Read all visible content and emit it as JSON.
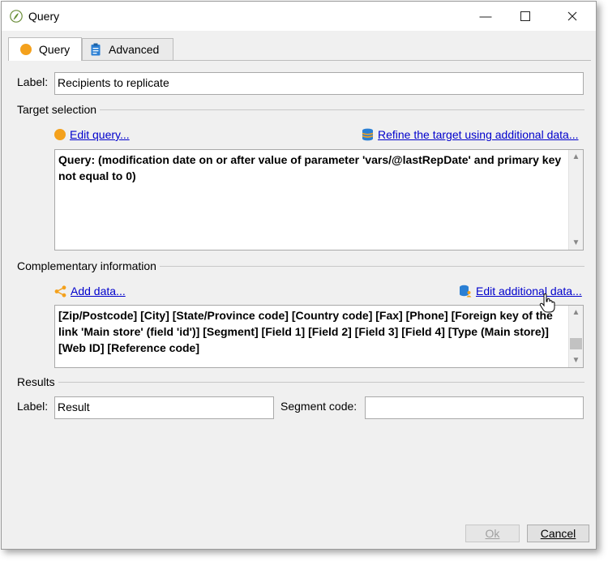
{
  "window": {
    "title": "Query"
  },
  "tabs": [
    {
      "label": "Query",
      "icon": "query-circle-icon",
      "active": true
    },
    {
      "label": "Advanced",
      "icon": "clipboard-icon",
      "active": false
    }
  ],
  "label_field": {
    "label": "Label:",
    "value": "Recipients to replicate"
  },
  "target": {
    "section_title": "Target selection",
    "edit_query": "Edit query...",
    "refine": "Refine the target using additional data...",
    "query_text": "Query: (modification date on or after value of parameter 'vars/@lastRepDate' and primary key not equal to 0)"
  },
  "complementary": {
    "section_title": "Complementary information",
    "add_data": "Add data...",
    "edit_additional": "Edit additional data...",
    "fields_text": "[Zip/Postcode]  [City]  [State/Province code]  [Country code]  [Fax]  [Phone]  [Foreign key of the link 'Main store' (field 'id')]  [Segment]  [Field 1]  [Field 2]  [Field 3]  [Field 4]  [Type (Main store)]  [Web ID]  [Reference code]"
  },
  "results": {
    "section_title": "Results",
    "label": "Label:",
    "label_value": "Result",
    "segment_label": "Segment code:",
    "segment_value": ""
  },
  "buttons": {
    "ok": "Ok",
    "cancel": "Cancel"
  },
  "colors": {
    "accent_orange": "#f4a11c",
    "link_blue": "#0000cc",
    "db_blue": "#2a7fd4"
  }
}
